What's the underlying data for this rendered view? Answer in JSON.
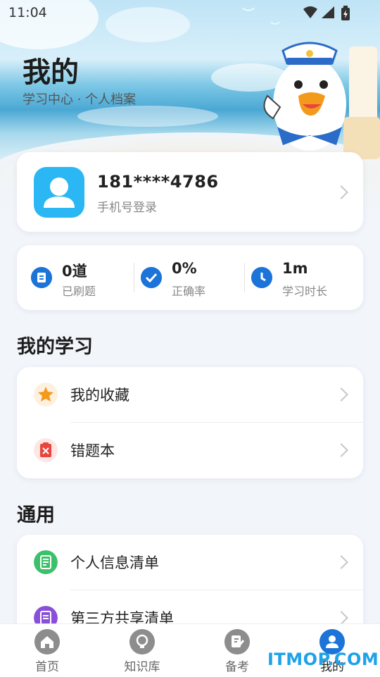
{
  "status_bar": {
    "time": "11:04"
  },
  "header": {
    "title": "我的",
    "subtitle": "学习中心 · 个人档案"
  },
  "profile": {
    "phone": "181****4786",
    "login_type": "手机号登录"
  },
  "stats": [
    {
      "value": "0道",
      "label": "已刷题",
      "icon": "list-icon"
    },
    {
      "value": "0%",
      "label": "正确率",
      "icon": "check-circle-icon"
    },
    {
      "value": "1m",
      "label": "学习时长",
      "icon": "clock-icon"
    }
  ],
  "my_study": {
    "title": "我的学习",
    "items": [
      {
        "label": "我的收藏",
        "icon": "star-icon"
      },
      {
        "label": "错题本",
        "icon": "wrong-book-icon"
      }
    ]
  },
  "general": {
    "title": "通用",
    "items": [
      {
        "label": "个人信息清单",
        "icon": "document-icon"
      },
      {
        "label": "第三方共享清单",
        "icon": "share-list-icon"
      }
    ]
  },
  "tabs": [
    {
      "label": "首页",
      "icon": "home-icon",
      "active": false
    },
    {
      "label": "知识库",
      "icon": "bulb-icon",
      "active": false
    },
    {
      "label": "备考",
      "icon": "notebook-edit-icon",
      "active": false
    },
    {
      "label": "我的",
      "icon": "user-icon",
      "active": true
    }
  ],
  "watermark": "ITMOP.COM",
  "colors": {
    "accent": "#1c74d8",
    "avatar_bg": "#2ab7f3",
    "star": "#f39a1c",
    "wrong": "#e8453c",
    "doc": "#3cc06a",
    "share": "#8a4fd8"
  }
}
